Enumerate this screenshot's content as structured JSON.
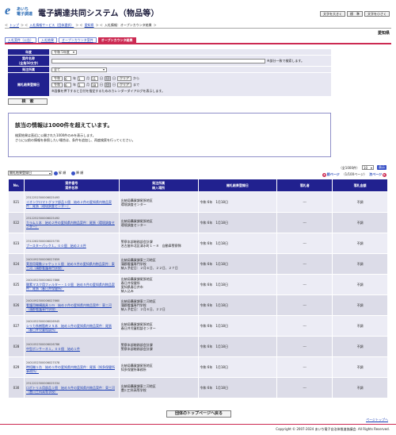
{
  "header": {
    "logo_line1": "あいち",
    "logo_line2": "電子調達",
    "title": "電子調達共同システム（物品等）",
    "font_buttons": [
      "文字を大きく",
      "標　準",
      "文字を小さく"
    ],
    "prefecture": "愛知県"
  },
  "breadcrumb": [
    "トップ",
    "入札情報サービス（団体選択）",
    "愛知県",
    "入札情報：オープンカウンタ結果"
  ],
  "tabs": [
    {
      "label": "入札案件（公告）",
      "active": false
    },
    {
      "label": "入札結果",
      "active": false
    },
    {
      "label": "オープンカウンタ案件",
      "active": false
    },
    {
      "label": "オープンカウンタ結果",
      "active": true
    }
  ],
  "search": {
    "year_label": "年度",
    "year_value": "令和 5年度",
    "case_label": "案件名称\n（全角50文字）",
    "case_note": "※部分一致で検索します。",
    "dept_label": "発注所属",
    "dept_value": "全て",
    "date_label": "開札結果登録日",
    "from_era": "令和",
    "from_y": "6",
    "from_m": "1",
    "from_d": "11",
    "to_era": "令和",
    "to_y": "6",
    "to_m": "1",
    "to_d": "18",
    "year_unit": "年",
    "month_unit": "月",
    "day_unit": "日",
    "cal_label": "日",
    "clear_label": "クリア",
    "from_word": "から",
    "to_word": "まで",
    "cal_note": "※画像を押下すると日付を指定するためのカレンダーダイアログを表示します。",
    "search_button": "検　索"
  },
  "notice": {
    "title": "該当の情報は1000件を超えています。",
    "line1": "検索結果は直近に公開された1000件のみを表示します。",
    "line2": "さらに以前の情報を参照したい場合は、条件を追加し、再度検索を行ってください。"
  },
  "controls": {
    "sort_value": "開札結果登録日",
    "asc_label": "昇 順",
    "desc_label": "降 順",
    "count_text": "（全1000件）",
    "per_page": "10",
    "per_button": "表示",
    "prev": "前ページ",
    "page_info": "（1/100ページ）",
    "next": "次ページ"
  },
  "table": {
    "headers": [
      "No.",
      "案件番号\n案件名称",
      "発注所属\n納入場所",
      "開札結果登録日",
      "落札者",
      "落札金額"
    ],
    "rows": [
      {
        "no": "021",
        "id": "2312252300006025493",
        "name": "イオンクロマトグラフ部品１個　始め２件の愛知県内物品案件：尾張（環境調査センター）",
        "dept": "出納局購買課尾張地区\n環境調査センター",
        "date": "令和 6年　1月18日",
        "winner": "---",
        "amount": "不調"
      },
      {
        "no": "022",
        "id": "2312252300006025492",
        "name": "カラム１本　始め２件の愛知県内物品案件：尾張（環境調査センター）",
        "dept": "出納局購買課尾張地区\n環境調査センター",
        "date": "令和 6年　1月18日",
        "winner": "---",
        "amount": "不調"
      },
      {
        "no": "023",
        "id": "2312262300006025735",
        "name": "ブースターパック１，００個　始め２４件",
        "dept": "警察本部総務部会計課\n名古屋市北区清水町１－８　自動車警察隊",
        "date": "令和 6年　1月18日",
        "winner": "---",
        "amount": "不調"
      },
      {
        "no": "024",
        "id": "2401092300006027659",
        "name": "実習用電動ジャケット１個　始め５件の愛知県内物品案件：東三河（蒲郡看護専門学校）",
        "dept": "出納局購買課東三河地区\n蒲郡看護専門学校\n納入予定日：２月６日、２２日、２７日",
        "date": "令和 6年　1月18日",
        "winner": "---",
        "amount": "不調"
      },
      {
        "no": "025",
        "id": "2401052300006027866",
        "name": "酸素マスク用フィルター・１０個　始め５件の愛知県内物品案件：尾張（春日井保健所）",
        "dept": "出納局購買課尾張地区\n春日井保健所\n愛知県春日井市\n納入込み",
        "date": "令和 6年　1月18日",
        "winner": "---",
        "amount": "不調"
      },
      {
        "no": "026",
        "id": "2401092300006027660",
        "name": "看護用機構器具１ｍ　始め２件の愛知県内物品案件：東三河（蒲郡看護専門学校）",
        "dept": "出納局購買課東三河地区\n蒲郡看護専門学校\n納入予定日：２月６日、２２日",
        "date": "令和 6年　1月18日",
        "winner": "---",
        "amount": "不調"
      },
      {
        "no": "027",
        "id": "2401052300006026945",
        "name": "シリカ系樹脂剤２５本　始め１件の愛知県内物品案件：尾張（春日井児童相談所）",
        "dept": "出納局購買課尾張地区\n春日井児童相談センター",
        "date": "令和 6年　1月18日",
        "winner": "---",
        "amount": "不調"
      },
      {
        "no": "028",
        "id": "2401052300006026786",
        "name": "中型ボンサーネ１，００個　始め１件",
        "dept": "警察本部総務部会計課\n警察本部総務部会計課",
        "date": "令和 6年　1月18日",
        "winner": "---",
        "amount": "不調"
      },
      {
        "no": "029",
        "id": "2401052300006027078",
        "name": "時短機１台　始め１件の愛知県内物品案件：尾張（知多保健所事務所）",
        "dept": "出納局購買課尾張地区\n知多保健所事務所",
        "date": "令和 6年　1月18日",
        "winner": "---",
        "amount": "不調"
      },
      {
        "no": "030",
        "id": "2312222300006025334",
        "name": "ロボトリル用部品１個　始め５件の愛知県内物品案件：東三河（豊川工科高等学校）",
        "dept": "出納局購買課東三河地区\n豊川工科高等学校",
        "date": "令和 6年　1月18日",
        "winner": "---",
        "amount": "不調"
      }
    ]
  },
  "footer": {
    "top_button": "団体のトップページへ戻る",
    "page_top": "ページトップへ",
    "copyright": "Copyright © 2007-2024 あいち電子自治体推進協議会. All Rights Reserved."
  }
}
